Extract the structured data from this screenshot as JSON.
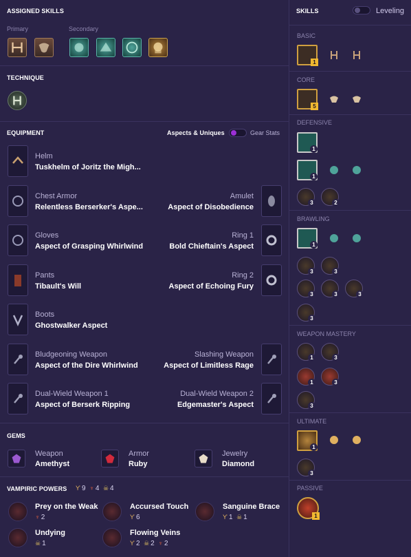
{
  "assigned": {
    "title": "ASSIGNED SKILLS",
    "primary": "Primary",
    "secondary": "Secondary"
  },
  "technique": {
    "title": "TECHNIQUE"
  },
  "equipment": {
    "title": "EQUIPMENT",
    "toggle_left": "Aspects & Uniques",
    "toggle_right": "Gear Stats",
    "items": [
      {
        "slot": "Helm",
        "name": "Tuskhelm of Joritz the Migh..."
      },
      {
        "slot": "Chest Armor",
        "name": "Relentless Berserker's Aspe..."
      },
      {
        "slot": "Amulet",
        "name": "Aspect of Disobedience"
      },
      {
        "slot": "Gloves",
        "name": "Aspect of Grasping Whirlwind"
      },
      {
        "slot": "Ring 1",
        "name": "Bold Chieftain's Aspect"
      },
      {
        "slot": "Pants",
        "name": "Tibault's Will"
      },
      {
        "slot": "Ring 2",
        "name": "Aspect of Echoing Fury"
      },
      {
        "slot": "Boots",
        "name": "Ghostwalker Aspect"
      },
      {
        "slot": "Bludgeoning Weapon",
        "name": "Aspect of the Dire Whirlwind"
      },
      {
        "slot": "Slashing Weapon",
        "name": "Aspect of Limitless Rage"
      },
      {
        "slot": "Dual-Wield Weapon 1",
        "name": "Aspect of Berserk Ripping"
      },
      {
        "slot": "Dual-Wield Weapon 2",
        "name": "Edgemaster's Aspect"
      }
    ]
  },
  "gems": {
    "title": "GEMS",
    "items": [
      {
        "slot": "Weapon",
        "name": "Amethyst",
        "color": "#9b59d0"
      },
      {
        "slot": "Armor",
        "name": "Ruby",
        "color": "#d02a3c"
      },
      {
        "slot": "Jewelry",
        "name": "Diamond",
        "color": "#e8dcc8"
      }
    ]
  },
  "vampiric": {
    "title": "VAMPIRIC POWERS",
    "totals": [
      "9",
      "4",
      "4"
    ],
    "powers": [
      {
        "name": "Prey on the Weak",
        "costs": [
          "2"
        ]
      },
      {
        "name": "Accursed Touch",
        "costs": [
          "6"
        ]
      },
      {
        "name": "Sanguine Brace",
        "costs": [
          "1",
          "1"
        ]
      },
      {
        "name": "Undying",
        "costs": [
          "1"
        ]
      },
      {
        "name": "Flowing Veins",
        "costs": [
          "2",
          "2",
          "2"
        ]
      }
    ]
  },
  "skills": {
    "title": "SKILLS",
    "toggle_label": "Leveling",
    "sections": [
      "BASIC",
      "CORE",
      "DEFENSIVE",
      "BRAWLING",
      "WEAPON MASTERY",
      "ULTIMATE",
      "PASSIVE"
    ],
    "badges": {
      "basic": "1",
      "core": "5",
      "def1": "1",
      "def2": "1",
      "def3": "3",
      "def4": "2",
      "br1": "1",
      "br2": "3",
      "br3": "3",
      "br4": "3",
      "br5": "3",
      "br6": "3",
      "br7": "3",
      "wm1": "1",
      "wm2": "3",
      "wm3": "1",
      "wm4": "3",
      "wm5": "3",
      "ult1": "1",
      "ult2": "3",
      "pas1": "1"
    }
  },
  "colors": {
    "bg": "#2a2347",
    "accent": "#9b2fd6",
    "gold": "#f0b830"
  }
}
